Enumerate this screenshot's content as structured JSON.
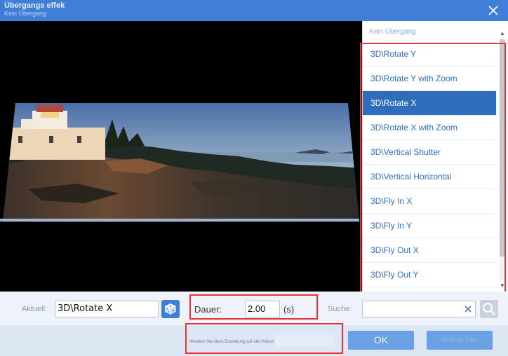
{
  "window": {
    "title": "Übergangs effek",
    "subtitle": "Kein Übergang",
    "close_icon": "close-icon"
  },
  "transitions": {
    "header": "Kein Übergang",
    "items": [
      "3D\\Rotate Y",
      "3D\\Rotate Y with Zoom",
      "3D\\Rotate X",
      "3D\\Rotate X with Zoom",
      "3D\\Vertical Shutter",
      "3D\\Vertical Horizontal",
      "3D\\Fly In X",
      "3D\\Fly In Y",
      "3D\\Fly Out X",
      "3D\\Fly Out Y"
    ],
    "selected_index": 2
  },
  "controls": {
    "aktuell_label": "Aktuell:",
    "aktuell_value": "3D\\Rotate X",
    "random_icon": "dice-icon",
    "dauer_label": "Dauer:",
    "dauer_value": "2.00",
    "dauer_unit": "(s)",
    "suche_label": "Suche:",
    "suche_value": "",
    "clear_icon": "clear-x-icon",
    "search_icon": "magnifier-icon"
  },
  "footer": {
    "apply_all_text": "Wenden Sie diese Einstellung auf alle Videos an",
    "ok_label": "OK",
    "cancel_label": "Abbrechen"
  },
  "colors": {
    "accent": "#3f7fd8",
    "selected": "#2f6cbc",
    "button": "#6aa0e4",
    "highlight": "#e8323a"
  }
}
